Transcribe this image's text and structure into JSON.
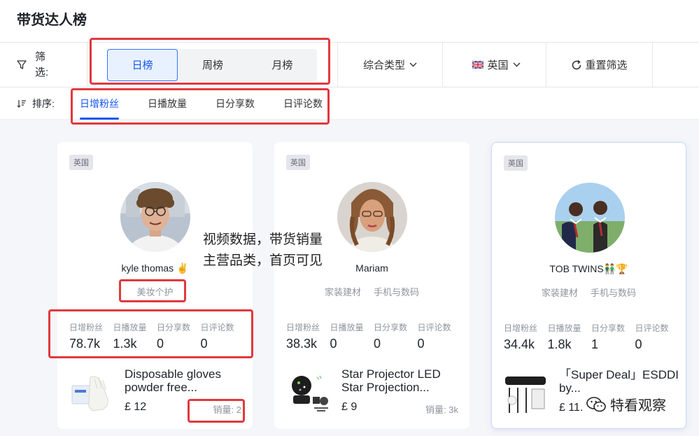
{
  "page": {
    "title": "带货达人榜"
  },
  "filter": {
    "label": "筛选:",
    "periods": [
      "日榜",
      "周榜",
      "月榜"
    ],
    "active_period": "日榜",
    "type_dropdown": "综合类型",
    "country_dropdown": "英国",
    "reset_label": "重置筛选"
  },
  "sort": {
    "label": "排序:",
    "tabs": [
      "日增粉丝",
      "日播放量",
      "日分享数",
      "日评论数"
    ],
    "active": "日增粉丝"
  },
  "stat_labels": [
    "日增粉丝",
    "日播放量",
    "日分享数",
    "日评论数"
  ],
  "cards": [
    {
      "badge": "英国",
      "name": "kyle thomas ✌️",
      "categories": [
        "美妆个护"
      ],
      "stats": [
        "78.7k",
        "1.3k",
        "0",
        "0"
      ],
      "product": {
        "title": "Disposable gloves powder free...",
        "price": "£ 12",
        "sales": "销量: 2"
      }
    },
    {
      "badge": "英国",
      "name": "Mariam",
      "categories": [
        "家装建材",
        "手机与数码"
      ],
      "stats": [
        "38.3k",
        "0",
        "0",
        "0"
      ],
      "product": {
        "title": "Star Projector LED Star Projection...",
        "price": "£ 9",
        "sales": "销量: 3k"
      }
    },
    {
      "badge": "英国",
      "name": "TOB TWINS👬🏆",
      "categories": [
        "家装建材",
        "手机与数码"
      ],
      "stats": [
        "34.4k",
        "1.8k",
        "1",
        "0"
      ],
      "product": {
        "title": "「Super Deal」ESDDI by...",
        "price": "£ 11.",
        "sales": ""
      }
    }
  ],
  "annotation": {
    "line1": "视频数据，带货销量",
    "line2": "主营品类，首页可见"
  },
  "watermark": "特看观察",
  "colors": {
    "accent": "#1456f0",
    "highlight_box": "#e0393e"
  }
}
